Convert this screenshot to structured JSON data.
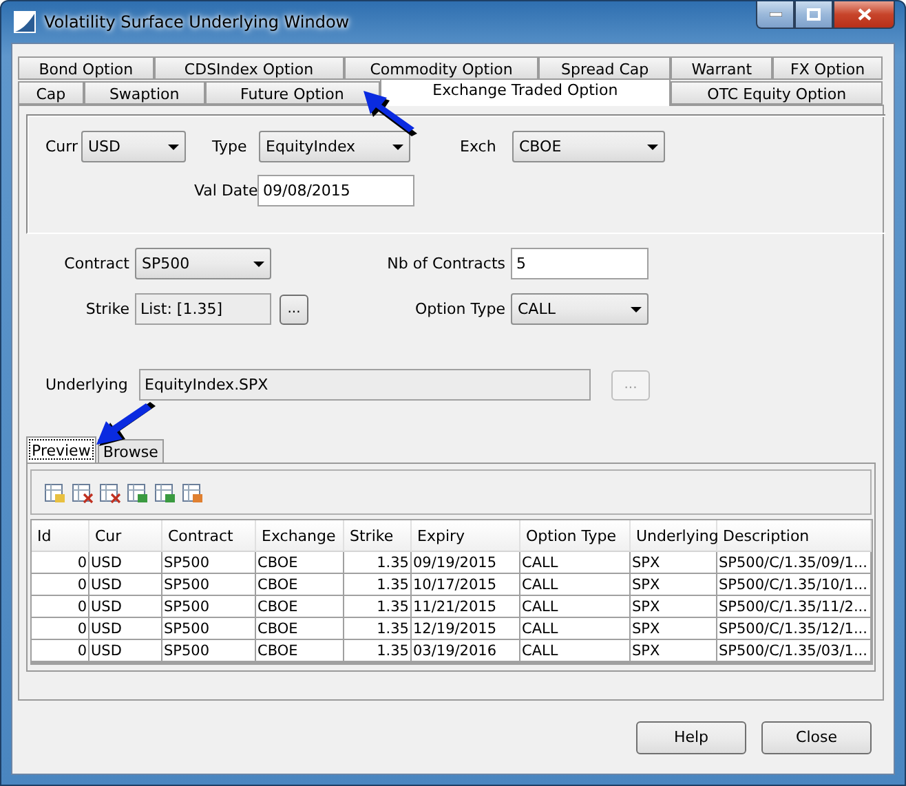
{
  "window": {
    "title": "Volatility Surface Underlying Window"
  },
  "tab_rows": [
    [
      {
        "label": "Bond Option",
        "selected": false
      },
      {
        "label": "CDSIndex Option",
        "selected": false
      },
      {
        "label": "Commodity Option",
        "selected": false
      },
      {
        "label": "Spread Cap",
        "selected": false
      },
      {
        "label": "Warrant",
        "selected": false
      },
      {
        "label": "FX Option",
        "selected": false
      }
    ],
    [
      {
        "label": "Cap",
        "selected": false
      },
      {
        "label": "Swaption",
        "selected": false
      },
      {
        "label": "Future Option",
        "selected": false
      },
      {
        "label": "Exchange Traded Option",
        "selected": true
      },
      {
        "label": "OTC Equity Option",
        "selected": false
      }
    ]
  ],
  "form": {
    "curr": {
      "label": "Curr",
      "value": "USD"
    },
    "type": {
      "label": "Type",
      "value": "EquityIndex"
    },
    "exch": {
      "label": "Exch",
      "value": "CBOE"
    },
    "val_date": {
      "label": "Val Date",
      "value": "09/08/2015"
    },
    "contract": {
      "label": "Contract",
      "value": "SP500"
    },
    "nb_contracts": {
      "label": "Nb of Contracts",
      "value": "5"
    },
    "strike": {
      "label": "Strike",
      "value": "List: [1.35]",
      "button": "..."
    },
    "option_type": {
      "label": "Option Type",
      "value": "CALL"
    },
    "underlying": {
      "label": "Underlying",
      "value": "EquityIndex.SPX",
      "button": "...",
      "button_disabled": true
    }
  },
  "sub_tabs": [
    {
      "label": "Preview",
      "selected": true
    },
    {
      "label": "Browse",
      "selected": false
    }
  ],
  "table": {
    "columns": [
      "Id",
      "Cur",
      "Contract",
      "Exchange",
      "Strike",
      "Expiry",
      "Option Type",
      "Underlying",
      "Description"
    ],
    "rows": [
      [
        "0",
        "USD",
        "SP500",
        "CBOE",
        "1.35",
        "09/19/2015",
        "CALL",
        "SPX",
        "SP500/C/1.35/09/1..."
      ],
      [
        "0",
        "USD",
        "SP500",
        "CBOE",
        "1.35",
        "10/17/2015",
        "CALL",
        "SPX",
        "SP500/C/1.35/10/1..."
      ],
      [
        "0",
        "USD",
        "SP500",
        "CBOE",
        "1.35",
        "11/21/2015",
        "CALL",
        "SPX",
        "SP500/C/1.35/11/2..."
      ],
      [
        "0",
        "USD",
        "SP500",
        "CBOE",
        "1.35",
        "12/19/2015",
        "CALL",
        "SPX",
        "SP500/C/1.35/12/1..."
      ],
      [
        "0",
        "USD",
        "SP500",
        "CBOE",
        "1.35",
        "03/19/2016",
        "CALL",
        "SPX",
        "SP500/C/1.35/03/1..."
      ]
    ]
  },
  "buttons": [
    "Help",
    "Close"
  ]
}
